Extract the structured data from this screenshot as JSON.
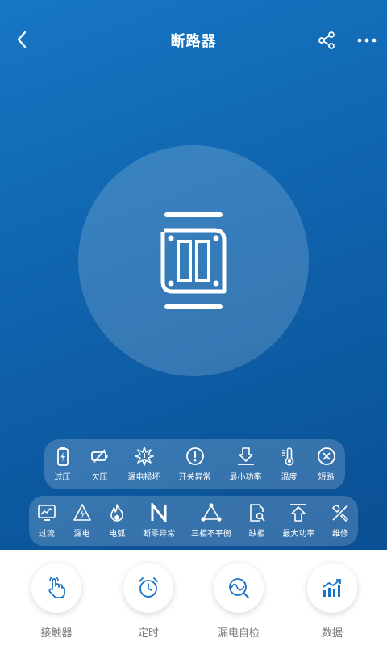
{
  "header": {
    "title": "断路器"
  },
  "colors": {
    "primary": "#0f63ad",
    "icon_blue": "#1a73c8",
    "white": "#ffffff"
  },
  "status_row1": [
    {
      "label": "过压",
      "icon": "battery-bolt-icon"
    },
    {
      "label": "欠压",
      "icon": "battery-slash-icon"
    },
    {
      "label": "漏电损坏",
      "icon": "burst-alert-icon"
    },
    {
      "label": "开关异常",
      "icon": "exclamation-circle-icon"
    },
    {
      "label": "最小功率",
      "icon": "download-arrow-icon"
    },
    {
      "label": "温度",
      "icon": "thermometer-icon"
    },
    {
      "label": "短路",
      "icon": "x-circle-icon"
    }
  ],
  "status_row2": [
    {
      "label": "过流",
      "icon": "monitor-wave-icon"
    },
    {
      "label": "漏电",
      "icon": "triangle-bolt-icon"
    },
    {
      "label": "电弧",
      "icon": "flame-icon"
    },
    {
      "label": "断零异常",
      "icon": "letter-n-icon"
    },
    {
      "label": "三相不平衡",
      "icon": "triangle-nodes-icon"
    },
    {
      "label": "缺相",
      "icon": "document-search-icon"
    },
    {
      "label": "最大功率",
      "icon": "upload-arrow-icon"
    },
    {
      "label": "维修",
      "icon": "tools-icon"
    }
  ],
  "actions": [
    {
      "label": "接触器",
      "icon": "hand-touch-icon"
    },
    {
      "label": "定时",
      "icon": "alarm-clock-icon"
    },
    {
      "label": "漏电自检",
      "icon": "wave-search-icon"
    },
    {
      "label": "数据",
      "icon": "chart-growth-icon"
    }
  ]
}
